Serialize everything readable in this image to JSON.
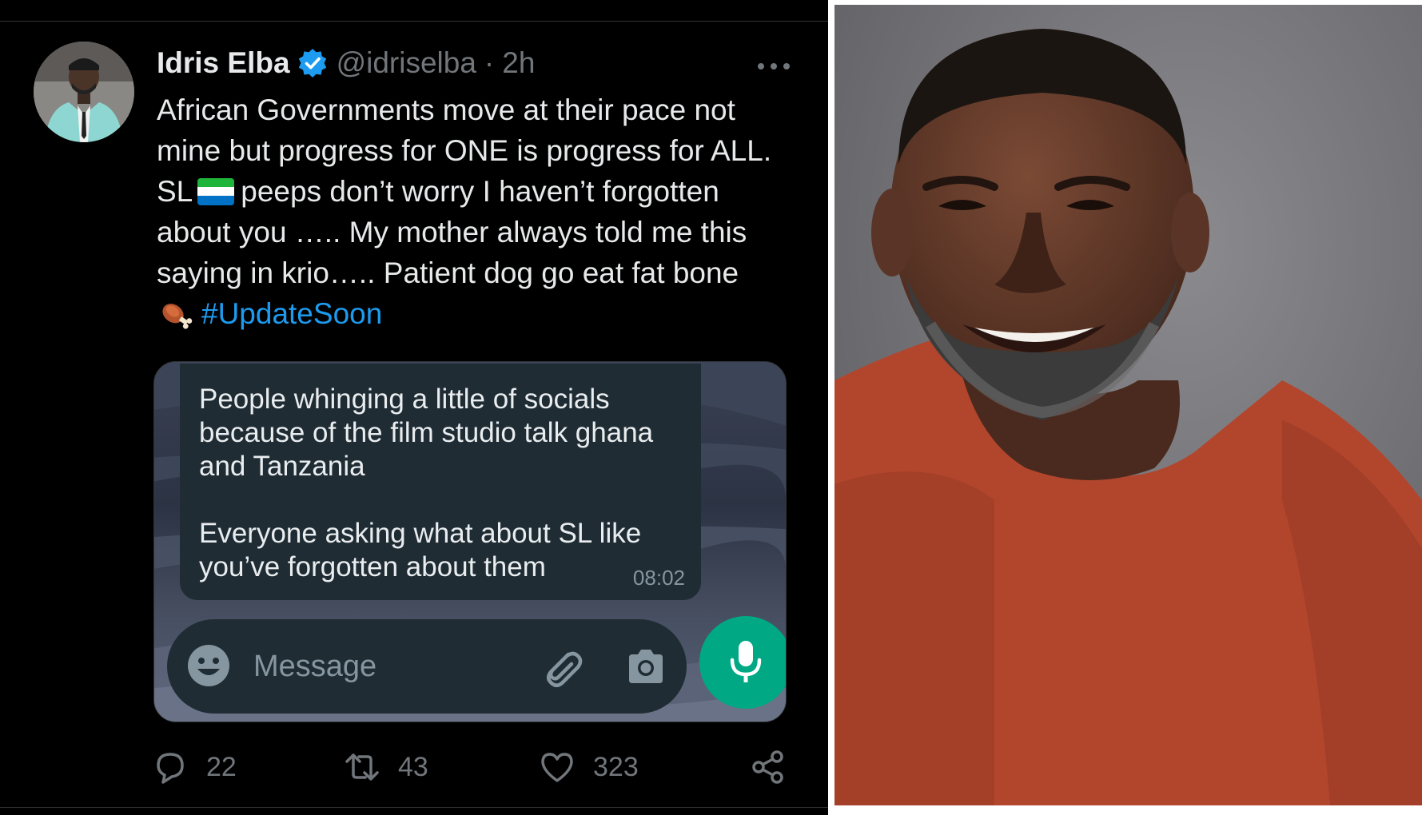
{
  "tweet": {
    "author": {
      "display_name": "Idris Elba",
      "handle": "@idriselba",
      "separator": "·",
      "time": "2h",
      "verified": true
    },
    "text_lines": [
      "African Governments move at their pace not",
      "mine but progress for ONE is progress for ALL.",
      {
        "prefix": "SL",
        "emoji": "sierra-leone-flag",
        "suffix": "peeps don’t worry I haven’t forgotten"
      },
      "about you ….. My mother always told me this",
      "saying in krio….. Patient dog go eat fat bone",
      {
        "emoji": "meat-on-bone",
        "hashtag": "#UpdateSoon"
      }
    ],
    "media": {
      "chat_message": {
        "paragraph_1": [
          "People whinging a little of socials",
          "because of the film studio talk ghana",
          "and Tanzania"
        ],
        "paragraph_2": [
          "Everyone asking what about SL like",
          "you’ve forgotten about them"
        ],
        "time": "08:02"
      },
      "composer": {
        "placeholder": "Message",
        "icons": [
          "emoji-icon",
          "paperclip-icon",
          "camera-icon",
          "microphone-icon"
        ]
      }
    },
    "actions": {
      "replies": "22",
      "retweets": "43",
      "likes": "323"
    }
  },
  "colors": {
    "background": "#000000",
    "text": "#e7e9ea",
    "muted": "#71767b",
    "link": "#1d9bf0",
    "verified": "#1d9bf0",
    "chat_bubble": "#1f2c34",
    "mic_button": "#00a884",
    "photo_background": "#76767a"
  }
}
